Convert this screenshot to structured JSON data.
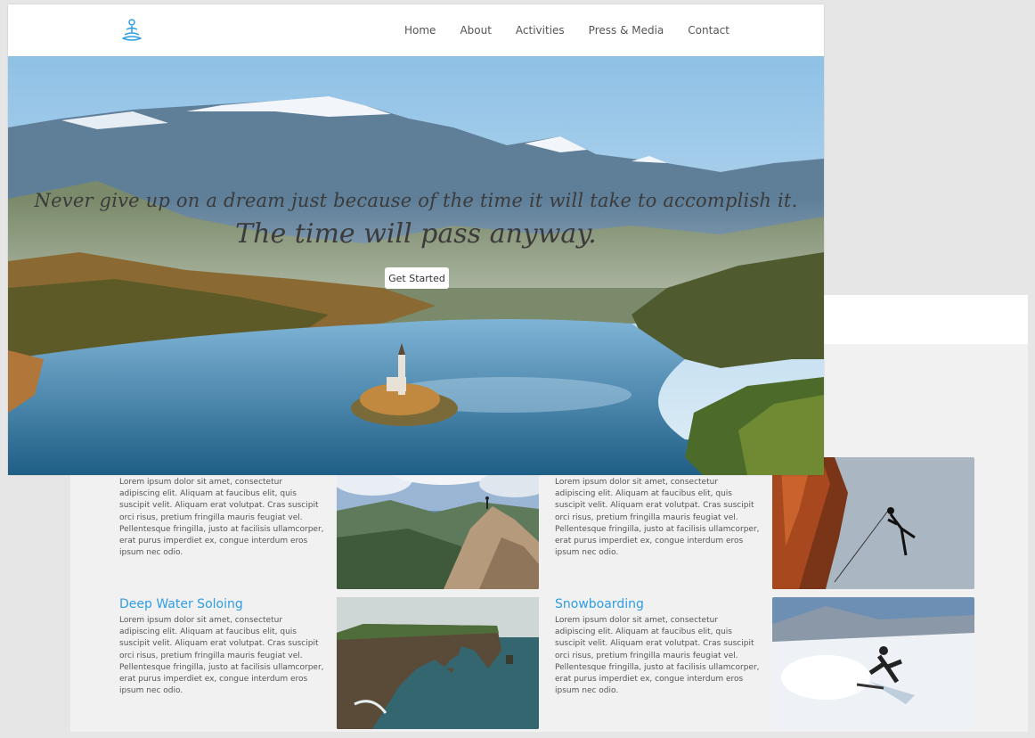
{
  "nav": {
    "logo": "meditation-logo-icon",
    "links": [
      "Home",
      "About",
      "Activities",
      "Press & Media",
      "Contact"
    ]
  },
  "hero": {
    "quote_line1": "Never give up on a dream just because of the time it will take to accomplish it.",
    "quote_line2": "The time will pass anyway.",
    "button_label": "Get Started"
  },
  "activities": [
    {
      "title": "",
      "text": "Lorem ipsum dolor sit amet, consectetur adipiscing elit. Aliquam at faucibus elit, quis suscipit velit. Aliquam erat volutpat. Cras suscipit orci risus, pretium fringilla mauris feugiat vel. Pellentesque fringilla, justo at facilisis ullamcorper, erat purus imperdiet ex, congue interdum eros ipsum nec odio."
    },
    {
      "title": "",
      "text": "Lorem ipsum dolor sit amet, consectetur adipiscing elit. Aliquam at faucibus elit, quis suscipit velit. Aliquam erat volutpat. Cras suscipit orci risus, pretium fringilla mauris feugiat vel. Pellentesque fringilla, justo at facilisis ullamcorper, erat purus imperdiet ex, congue interdum eros ipsum nec odio."
    },
    {
      "title": "Deep Water Soloing",
      "text": "Lorem ipsum dolor sit amet, consectetur adipiscing elit. Aliquam at faucibus elit, quis suscipit velit. Aliquam erat volutpat. Cras suscipit orci risus, pretium fringilla mauris feugiat vel. Pellentesque fringilla, justo at facilisis ullamcorper, erat purus imperdiet ex, congue interdum eros ipsum nec odio."
    },
    {
      "title": "Snowboarding",
      "text": "Lorem ipsum dolor sit amet, consectetur adipiscing elit. Aliquam at faucibus elit, quis suscipit velit. Aliquam erat volutpat. Cras suscipit orci risus, pretium fringilla mauris feugiat vel. Pellentesque fringilla, justo at facilisis ullamcorper, erat purus imperdiet ex, congue interdum eros ipsum nec odio."
    }
  ],
  "colors": {
    "accent": "#2f9de3",
    "background": "#e6e6e6",
    "section_bg": "#f1f1f1"
  }
}
